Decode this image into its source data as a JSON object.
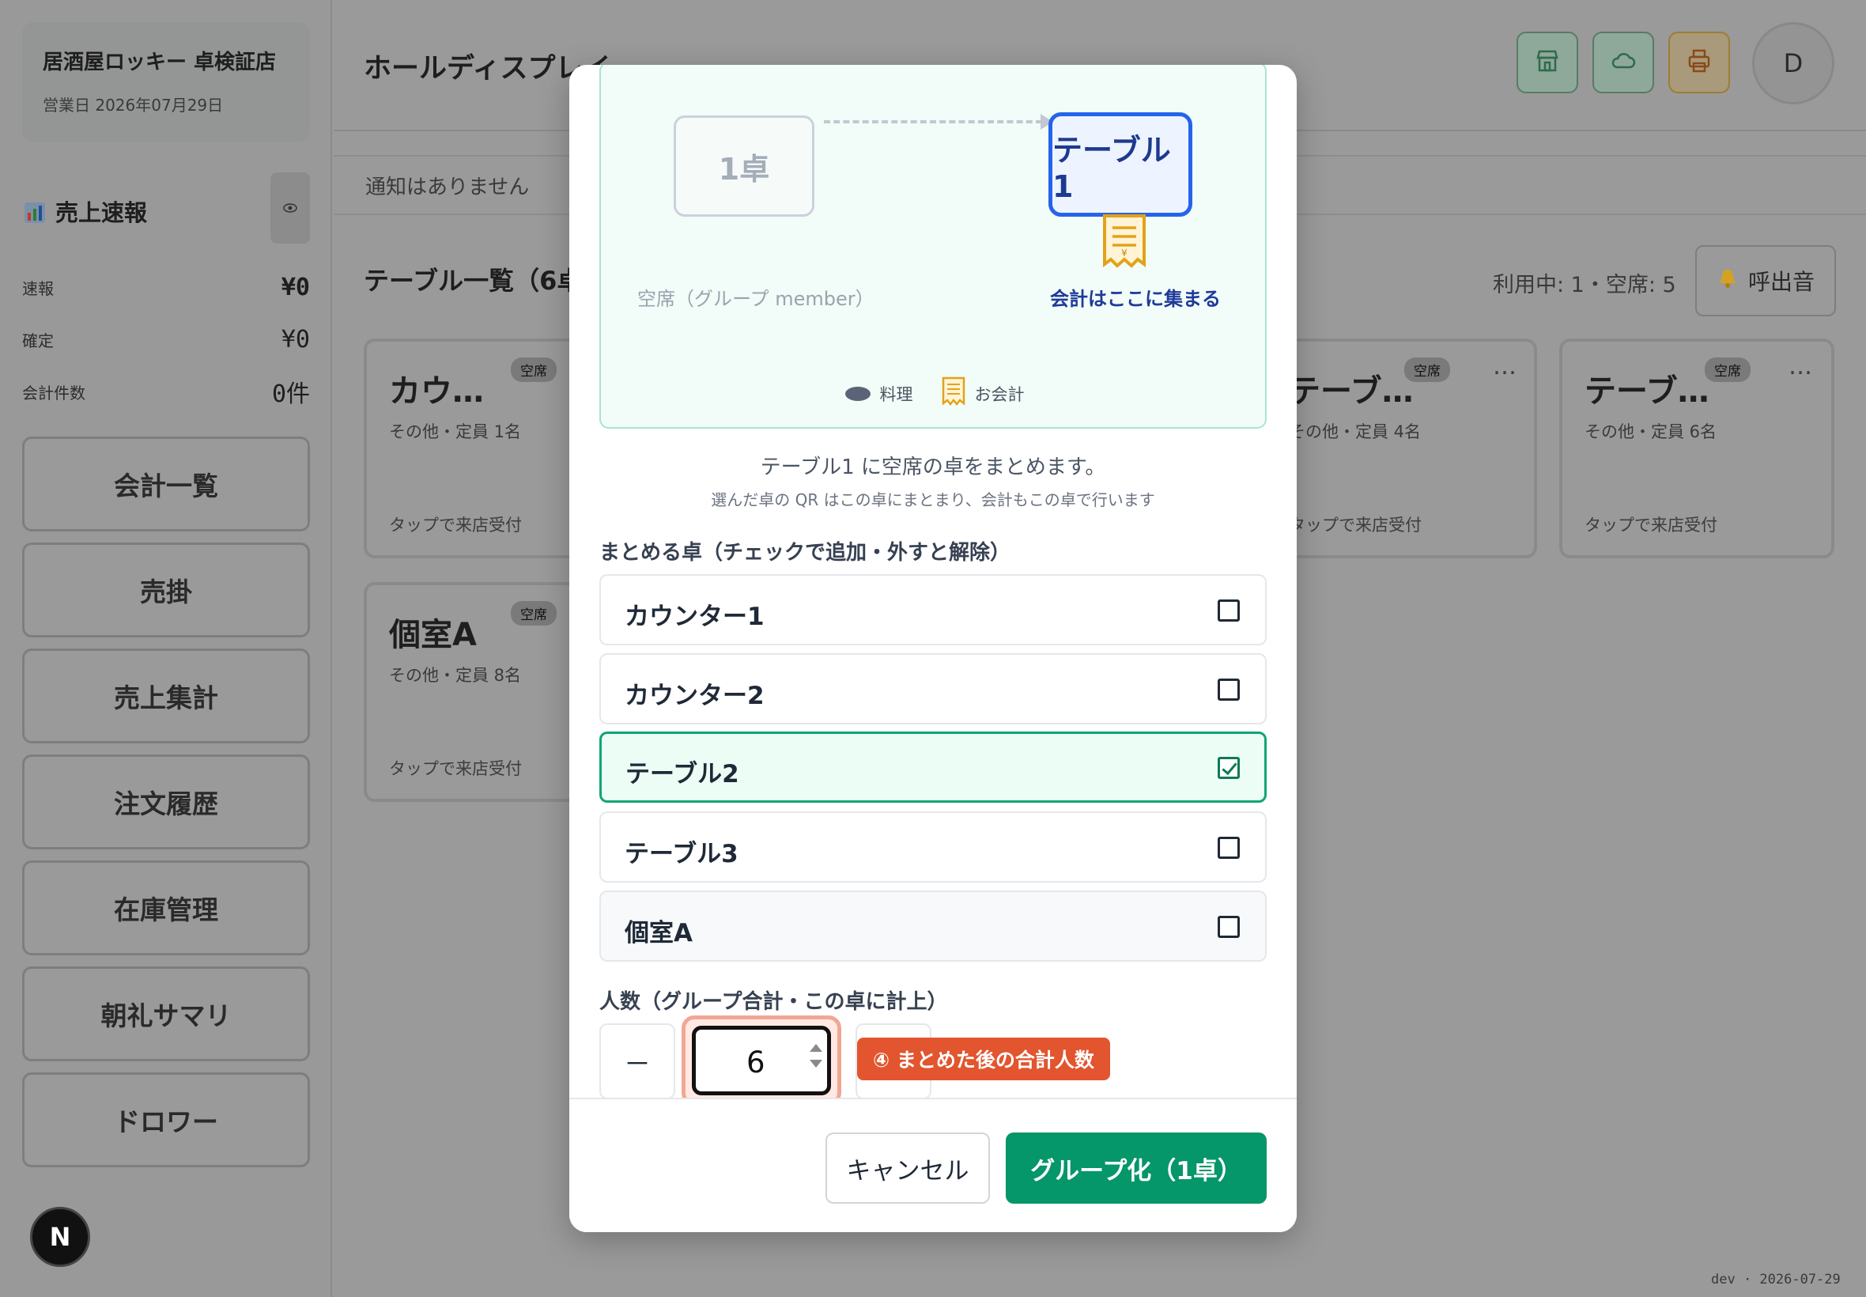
{
  "sidebar": {
    "store_name": "居酒屋ロッキー 卓検証店",
    "business_date": "営業日 2026年07月29日",
    "sales_title": "売上速報",
    "rows": [
      {
        "label": "速報",
        "value": "¥0"
      },
      {
        "label": "確定",
        "value": "¥0"
      },
      {
        "label": "会計件数",
        "value": "0件"
      }
    ],
    "nav": [
      "会計一覧",
      "売掛",
      "売上集計",
      "注文履歴",
      "在庫管理",
      "朝礼サマリ",
      "ドロワー"
    ],
    "badge": "N"
  },
  "header": {
    "title": "ホールディスプレイ",
    "avatar": "D"
  },
  "notice": "通知はありません",
  "list": {
    "title": "テーブル一覧（6卓）",
    "usage": "利用中: 1・空席: 5",
    "call_button": "呼出音",
    "cards": [
      {
        "name": "カウ…",
        "meta": "その他・定員 1名",
        "hint": "タップで来店受付",
        "badge": "空席"
      },
      {
        "name": "テーブ…",
        "meta": "その他・定員 4名",
        "hint": "タップで来店受付",
        "badge": "空席"
      },
      {
        "name": "テーブ…",
        "meta": "その他・定員 6名",
        "hint": "タップで来店受付",
        "badge": "空席"
      },
      {
        "name": "個室A",
        "meta": "その他・定員 8名",
        "hint": "タップで来店受付",
        "badge": "空席"
      }
    ],
    "more": "…"
  },
  "modal": {
    "diagram": {
      "ghost_table": "1卓",
      "target_table": "テーブル1",
      "ghost_caption": "空席（グループ member）",
      "target_caption": "会計はここに集まる",
      "legend_dish": "料理",
      "legend_bill": "お会計"
    },
    "desc1": "テーブル1 に空席の卓をまとめます。",
    "desc2": "選んだ卓の QR はこの卓にまとまり、会計もこの卓で行います",
    "tables_label": "まとめる卓（チェックで追加・外すと解除）",
    "options": [
      {
        "label": "カウンター1",
        "checked": false
      },
      {
        "label": "カウンター2",
        "checked": false
      },
      {
        "label": "テーブル2",
        "checked": true
      },
      {
        "label": "テーブル3",
        "checked": false
      },
      {
        "label": "個室A",
        "checked": false
      }
    ],
    "people_label": "人数（グループ合計・この卓に計上）",
    "people_value": "6",
    "minus": "－",
    "callout": "④ まとめた後の合計人数",
    "cancel": "キャンセル",
    "submit": "グループ化（1卓）"
  },
  "footer_dev": "dev · 2026-07-29",
  "colors": {
    "accent_green": "#059669",
    "accent_blue": "#2563eb",
    "callout_orange": "#e2552e"
  }
}
